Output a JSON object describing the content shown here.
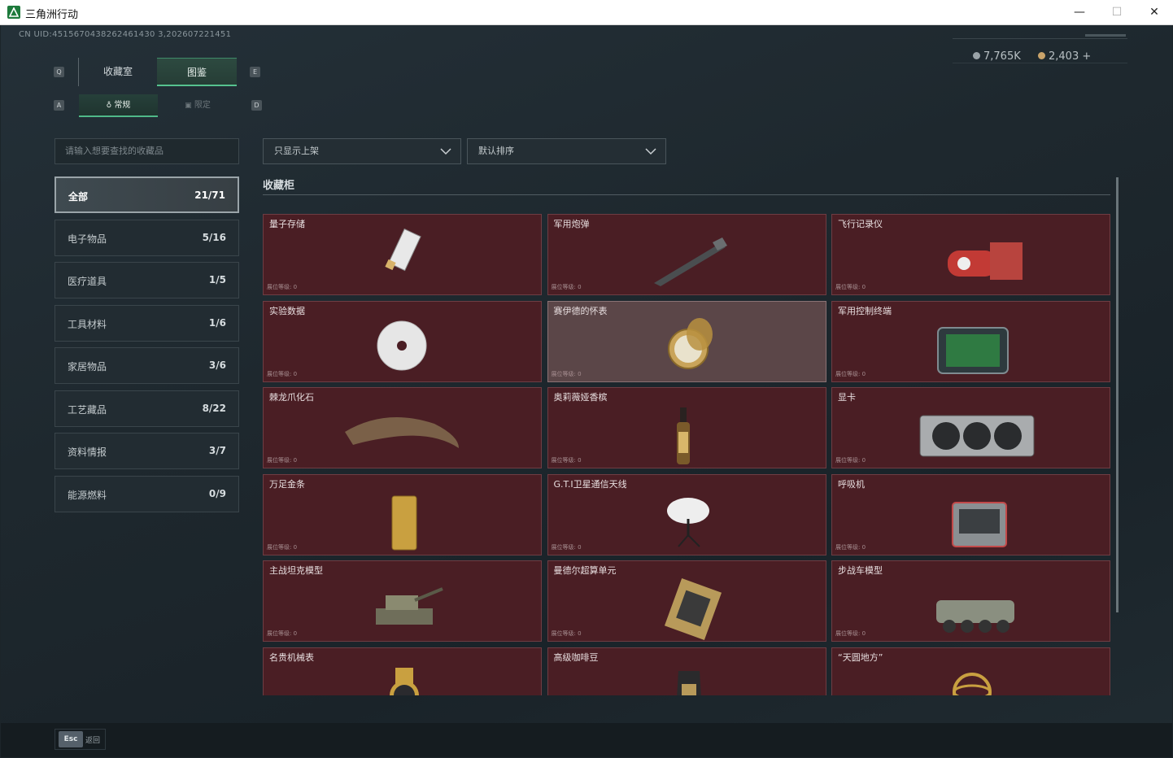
{
  "window": {
    "title": "三角洲行动",
    "minimize": "—",
    "maximize": "☐",
    "close": "✕"
  },
  "header": {
    "uid": "CN UID:4515670438262461430 3,202607221451",
    "currency_1": "7,765K",
    "currency_2": "2,403 +"
  },
  "keys": {
    "q": "Q",
    "e": "E",
    "a": "A",
    "d": "D"
  },
  "tabs": {
    "collection": "收藏室",
    "atlas": "图鉴"
  },
  "subtabs": {
    "normal": "常规",
    "limited": "限定"
  },
  "search": {
    "placeholder": "请输入想要查找的收藏品"
  },
  "categories": [
    {
      "label": "全部",
      "count": "21/71"
    },
    {
      "label": "电子物品",
      "count": "5/16"
    },
    {
      "label": "医疗道具",
      "count": "1/5"
    },
    {
      "label": "工具材料",
      "count": "1/6"
    },
    {
      "label": "家居物品",
      "count": "3/6"
    },
    {
      "label": "工艺藏品",
      "count": "8/22"
    },
    {
      "label": "资料情报",
      "count": "3/7"
    },
    {
      "label": "能源燃料",
      "count": "0/9"
    }
  ],
  "filters": {
    "listing": "只显示上架",
    "sort": "默认排序"
  },
  "section_title": "收藏柜",
  "items": [
    {
      "name": "量子存储",
      "level": "展位等级: 0",
      "icon": "usb-drive-icon"
    },
    {
      "name": "军用炮弹",
      "level": "展位等级: 0",
      "icon": "missile-icon"
    },
    {
      "name": "飞行记录仪",
      "level": "展位等级: 0",
      "icon": "flight-recorder-icon"
    },
    {
      "name": "实验数据",
      "level": "展位等级: 0",
      "icon": "disc-icon"
    },
    {
      "name": "赛伊德的怀表",
      "level": "展位等级: 0",
      "icon": "pocket-watch-icon"
    },
    {
      "name": "军用控制终端",
      "level": "展位等级: 0",
      "icon": "control-terminal-icon"
    },
    {
      "name": "棘龙爪化石",
      "level": "展位等级: 0",
      "icon": "claw-fossil-icon"
    },
    {
      "name": "奥莉薇娅香槟",
      "level": "展位等级: 0",
      "icon": "champagne-icon"
    },
    {
      "name": "显卡",
      "level": "展位等级: 0",
      "icon": "graphics-card-icon"
    },
    {
      "name": "万足金条",
      "level": "展位等级: 0",
      "icon": "gold-bar-icon"
    },
    {
      "name": "G.T.I卫星通信天线",
      "level": "展位等级: 0",
      "icon": "satellite-dish-icon"
    },
    {
      "name": "呼吸机",
      "level": "展位等级: 0",
      "icon": "ventilator-icon"
    },
    {
      "name": "主战坦克模型",
      "level": "展位等级: 0",
      "icon": "tank-model-icon"
    },
    {
      "name": "曼德尔超算单元",
      "level": "展位等级: 0",
      "icon": "compute-unit-icon"
    },
    {
      "name": "步战车模型",
      "level": "展位等级: 0",
      "icon": "ifv-model-icon"
    },
    {
      "name": "名贵机械表",
      "level": "",
      "icon": "wristwatch-icon"
    },
    {
      "name": "高级咖啡豆",
      "level": "",
      "icon": "coffee-bag-icon"
    },
    {
      "name": "“天圆地方”",
      "level": "",
      "icon": "armillary-icon"
    }
  ],
  "footer": {
    "esc_key": "Esc",
    "esc_label": "返回"
  },
  "colors": {
    "accent": "#56c28f",
    "card_bg": "#4a1e24",
    "card_highlight": "#5b4648"
  }
}
